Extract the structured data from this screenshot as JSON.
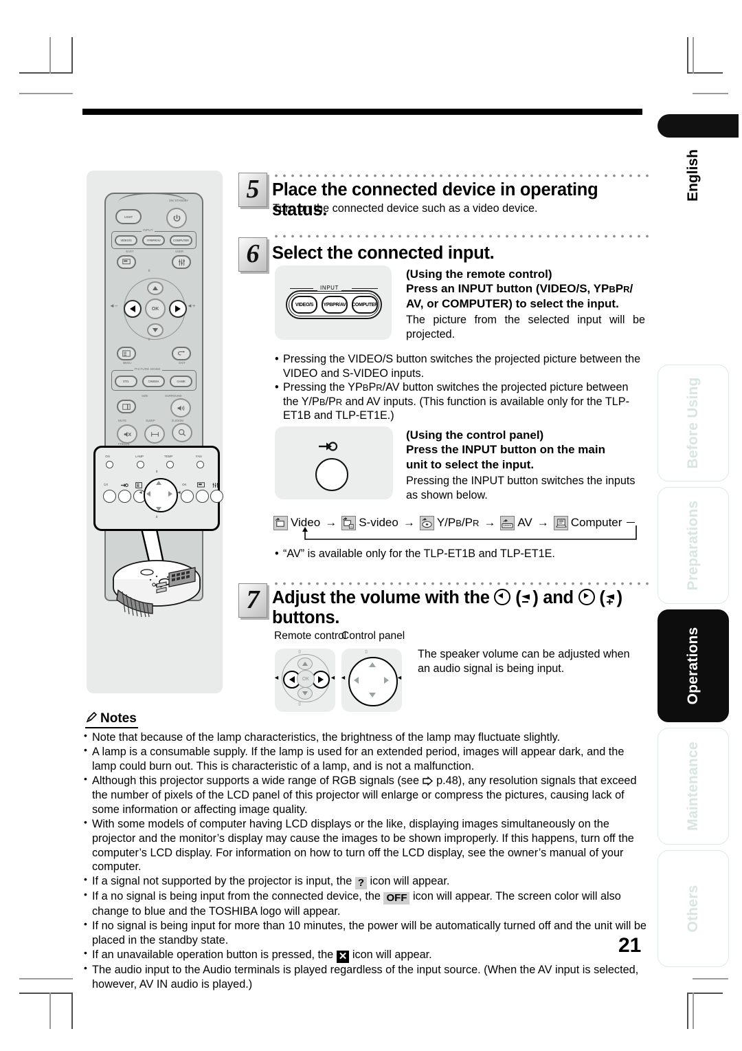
{
  "page": {
    "number": "21",
    "language_label": "English"
  },
  "side_tabs": [
    {
      "label": "Before Using",
      "active": false
    },
    {
      "label": "Preparations",
      "active": false
    },
    {
      "label": "Operations",
      "active": true
    },
    {
      "label": "Maintenance",
      "active": false
    },
    {
      "label": "Others",
      "active": false
    }
  ],
  "steps": [
    {
      "number": "5",
      "title": "Place the connected device in operating status.",
      "body": "Turn on the connected device such as a video device."
    },
    {
      "number": "6",
      "title": "Select the connected input."
    },
    {
      "number": "7",
      "title": "Adjust the volume with the ◀ (◂–) and ▶ (◂+) buttons."
    }
  ],
  "step6": {
    "remote": {
      "heading": "(Using the remote control)",
      "instruction": "Press an INPUT button (VIDEO/S, YPBPR/ AV, or COMPUTER) to select the input.",
      "instruction_line1": "Press an INPUT button (VIDEO/S, YP",
      "instruction_sc1": "B",
      "instruction_mid": "P",
      "instruction_sc2": "R",
      "instruction_line1_end": "/",
      "instruction_line2": "AV, or COMPUTER) to select the input.",
      "body": "The picture from the selected input will be projected.",
      "panel_group_label": "INPUT",
      "buttons": [
        "VIDEO/S",
        "YPBPR/AV",
        "COMPUTER"
      ]
    },
    "bullets": [
      "Pressing the VIDEO/S button switches the projected picture between the VIDEO and S-VIDEO inputs.",
      "Pressing the YPBPR/AV button switches the projected picture between the Y/PB/PR and AV inputs. (This function is available only for the TLP-ET1B and TLP-ET1E.)"
    ],
    "control_panel": {
      "heading": "(Using the control panel)",
      "instruction_line1": "Press the INPUT button on the main",
      "instruction_line2": "unit to select the input.",
      "body": "Pressing the INPUT button switches the inputs as shown below."
    },
    "input_sequence": [
      {
        "icon": "video-input-icon",
        "label": "Video"
      },
      {
        "icon": "s-video-input-icon",
        "label": "S-video"
      },
      {
        "icon": "component-input-icon",
        "label": "Y/PB/PR"
      },
      {
        "icon": "av-input-icon",
        "label": "AV"
      },
      {
        "icon": "computer-input-icon",
        "label": "Computer"
      }
    ],
    "sequence_arrow": "→",
    "footnote": "“AV” is available only for the TLP-ET1B and TLP-ET1E."
  },
  "step7": {
    "caption_remote": "Remote control",
    "caption_panel": "Control panel",
    "body": "The speaker volume can be adjusted when an audio signal is being input."
  },
  "notes": {
    "heading": "Notes",
    "items": [
      "Note that because of the lamp characteristics, the brightness of the lamp may fluctuate slightly.",
      "A lamp is a consumable supply.  If the lamp is used for an extended period, images will appear dark, and the lamp could burn out.  This is characteristic of a lamp, and is not a malfunction.",
      "Although this projector supports a wide range of RGB signals (see ➡ p.48), any resolution signals that exceed the number of pixels of the LCD panel of this projector will enlarge or compress the pictures, causing lack of some information or affecting image quality.",
      "With some models of computer having LCD displays or the like, displaying images simultaneously on the projector and the monitor’s display may cause the images to be shown improperly. If this happens, turn off the computer’s LCD display. For information on how to turn off the LCD display, see the owner’s manual of your computer.",
      "If a signal not supported by the projector is input, the ? icon will appear.",
      "If a no signal is being input from the connected device, the OFF icon will appear. The screen color will also change to blue and the TOSHIBA logo will appear.",
      "If no signal is being input for more than 10 minutes, the power will be automatically turned off and the unit will be placed in the standby state.",
      "If an unavailable operation button is pressed, the ✕ icon will appear.",
      "The audio input to the Audio terminals is played regardless of the input source. (When the AV input is selected, however, AV IN audio is played.)"
    ],
    "inline_icons": {
      "unsupported": "?",
      "no_signal": "OFF",
      "unavailable": "✕",
      "page_ref": "p.48"
    }
  },
  "remote_illustration": {
    "light_label": "LIGHT",
    "power_label": "ON/ STANDBY",
    "input_group": "INPUT",
    "input_buttons": [
      "VIDEO/S",
      "YPBPR/AV",
      "COMPUTER"
    ],
    "easy_label": "EASY",
    "user_label": "USER",
    "ok_label": "OK",
    "menu_label": "MENU",
    "exit_label": "EXIT",
    "picture_mode_group": "PICTURE MODE",
    "picture_mode_buttons": [
      "STD.",
      "CINEMA",
      "GAME"
    ],
    "size_label": "SIZE",
    "surround_label": "SURROUND",
    "mute_label": "MUTE",
    "sleep_label": "SLEEP",
    "freeze_label": "FREEZE",
    "dzoom_label": "D.ZOOM",
    "vol_minus": "–",
    "vol_plus": "+"
  },
  "control_panel_illustration": {
    "indicators": [
      "ON",
      "LAMP",
      "TEMP",
      "FAN"
    ],
    "buttons": [
      "⏻/I",
      "input",
      "menu",
      "OK",
      "easy",
      "user"
    ],
    "ok_label": "OK"
  },
  "colors": {
    "accent_tab": "#d8e6e3",
    "active_tab_bg": "#0d0d0d",
    "illustration_bg": "#e9ebea",
    "photo_box_bg": "#eceeee",
    "rule": "#000000"
  }
}
